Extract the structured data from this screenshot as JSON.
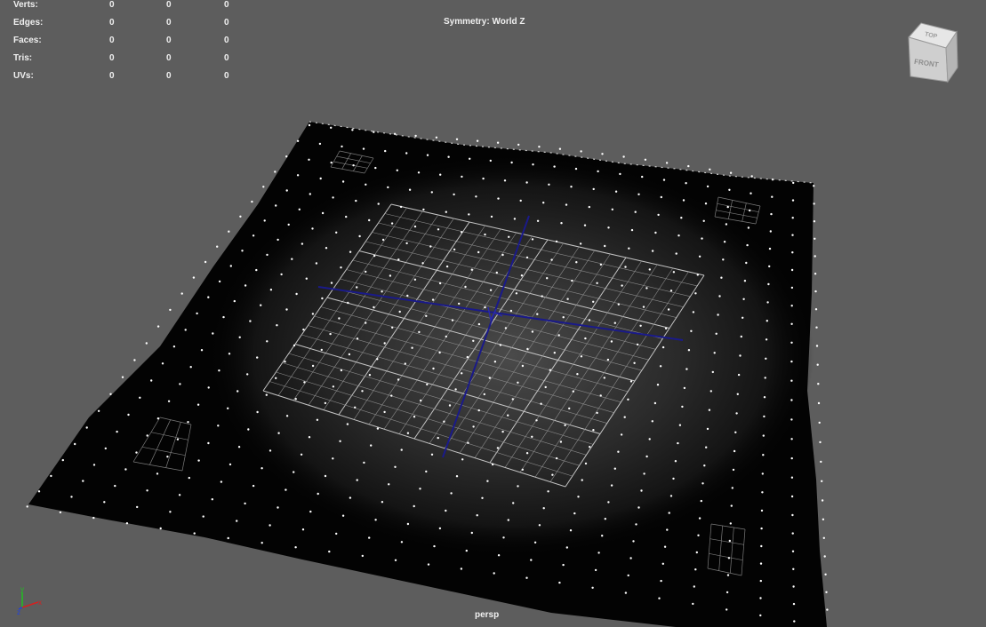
{
  "hud": {
    "rows": [
      {
        "label": "Verts:",
        "values": [
          "0",
          "0",
          "0"
        ]
      },
      {
        "label": "Edges:",
        "values": [
          "0",
          "0",
          "0"
        ]
      },
      {
        "label": "Faces:",
        "values": [
          "0",
          "0",
          "0"
        ]
      },
      {
        "label": "Tris:",
        "values": [
          "0",
          "0",
          "0"
        ]
      },
      {
        "label": "UVs:",
        "values": [
          "0",
          "0",
          "0"
        ]
      }
    ]
  },
  "symmetry": "Symmetry: World Z",
  "camera": "persp",
  "viewcube": {
    "top": "TOP",
    "front": "FRONT"
  },
  "axis": {
    "x": "x",
    "y": "y",
    "z": "z"
  },
  "colors": {
    "background": "#5d5d5d",
    "mesh": "#030303",
    "grid": "#9a9a9a",
    "grid_axis": "#1a1a8a",
    "vertex": "#ffffff",
    "axis_x": "#d42020",
    "axis_y": "#20c020",
    "axis_z": "#2040e0"
  }
}
